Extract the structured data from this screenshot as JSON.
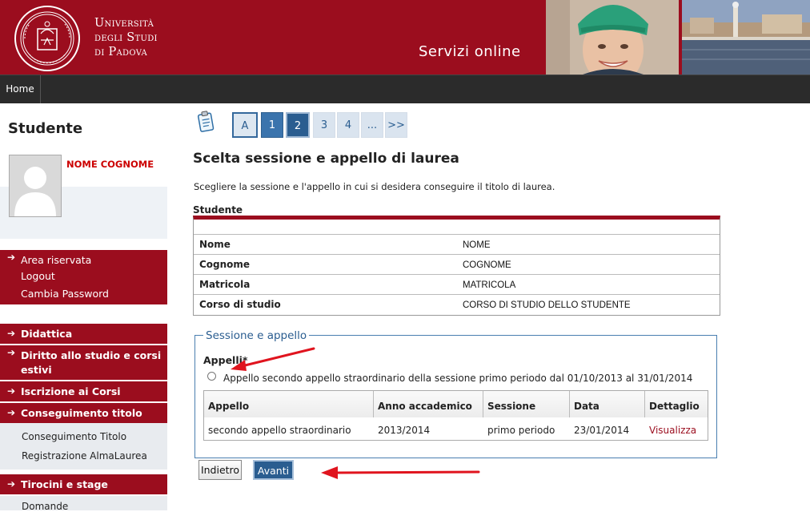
{
  "header": {
    "university_lines": [
      "Università",
      "degli Studi",
      "di Padova"
    ],
    "service_title": "Servizi online"
  },
  "nav": {
    "home_label": "Home"
  },
  "sidebar": {
    "title": "Studente",
    "student_name": "NOME COGNOME",
    "reserved_area": {
      "title": "Area riservata",
      "items": [
        "Logout",
        "Cambia Password"
      ]
    },
    "menu": [
      {
        "label": "Didattica"
      },
      {
        "label": "Diritto allo studio e corsi estivi"
      },
      {
        "label": "Iscrizione ai Corsi"
      },
      {
        "label": "Conseguimento titolo"
      }
    ],
    "conseguimento_sub": [
      "Conseguimento Titolo",
      "Registrazione AlmaLaurea"
    ],
    "tirocini": {
      "label": "Tirocini e stage"
    },
    "tirocini_sub": [
      "Domande"
    ]
  },
  "pager": {
    "items": [
      "A",
      "1",
      "2",
      "3",
      "4",
      "...",
      ">>"
    ]
  },
  "main": {
    "title": "Scelta sessione e appello di laurea",
    "intro": "Scegliere la sessione e l'appello in cui si desidera conseguire il titolo di laurea.",
    "student_section_label": "Studente",
    "student_rows": [
      {
        "key": "Nome",
        "value": "NOME"
      },
      {
        "key": "Cognome",
        "value": "COGNOME"
      },
      {
        "key": "Matricola",
        "value": "MATRICOLA"
      },
      {
        "key": "Corso di studio",
        "value": "CORSO DI STUDIO DELLO STUDENTE"
      }
    ],
    "fieldset_legend": "Sessione e appello",
    "appelli_label": "Appelli*",
    "radio_label": "Appello secondo appello straordinario della sessione primo periodo dal 01/10/2013 al 31/01/2014",
    "table": {
      "headers": [
        "Appello",
        "Anno accademico",
        "Sessione",
        "Data",
        "Dettaglio"
      ],
      "row": [
        "secondo appello straordinario",
        "2013/2014",
        "primo periodo",
        "23/01/2014",
        "Visualizza"
      ]
    },
    "back_button": "Indietro",
    "next_button": "Avanti"
  },
  "colors": {
    "brand_red": "#9b0d1e",
    "nav_dark": "#2b2b2b",
    "accent_blue": "#2a5d90",
    "annotation_red": "#e0141e"
  }
}
